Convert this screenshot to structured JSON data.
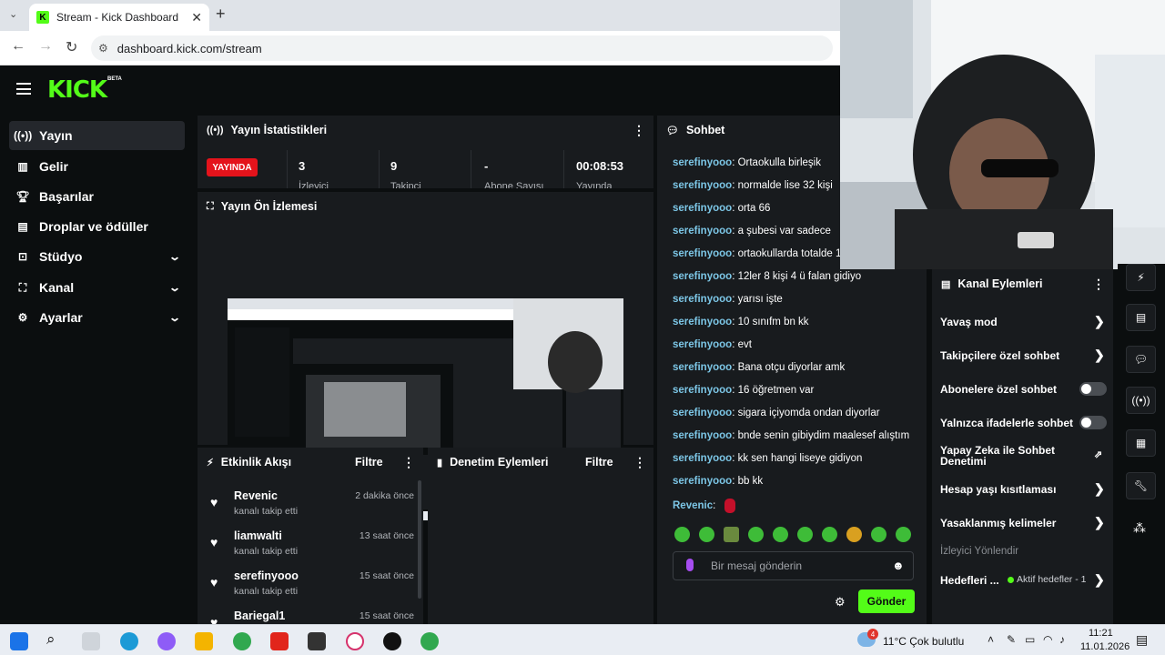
{
  "browser": {
    "tab_title": "Stream - Kick Dashboard",
    "tab_close": "✕",
    "new_tab": "+",
    "url": "dashboard.kick.com/stream"
  },
  "header": {
    "logo": "KICK",
    "beta": "BETA"
  },
  "sidebar": {
    "items": [
      {
        "label": "Yayın",
        "icon": "broadcast-icon",
        "active": true
      },
      {
        "label": "Gelir",
        "icon": "revenue-icon"
      },
      {
        "label": "Başarılar",
        "icon": "trophy-icon"
      },
      {
        "label": "Droplar ve ödüller",
        "icon": "gift-icon"
      },
      {
        "label": "Stüdyo",
        "icon": "studio-icon",
        "expandable": true
      },
      {
        "label": "Kanal",
        "icon": "channel-icon",
        "expandable": true
      },
      {
        "label": "Ayarlar",
        "icon": "gear-icon",
        "expandable": true
      }
    ]
  },
  "stats": {
    "title": "Yayın İstatistikleri",
    "live": "YAYINDA",
    "values": [
      "3",
      "9",
      "-",
      "00:08:53"
    ],
    "labels": [
      "İzleyici",
      "Takipçi",
      "Abone Sayısı",
      "Yayında"
    ]
  },
  "preview": {
    "title": "Yayın Ön İzlemesi"
  },
  "activity": {
    "title": "Etkinlik Akışı",
    "filter": "Filtre",
    "events": [
      {
        "name": "Revenic",
        "action": "kanalı takip etti",
        "time": "2 dakika önce"
      },
      {
        "name": "liamwalti",
        "action": "kanalı takip etti",
        "time": "13 saat önce"
      },
      {
        "name": "serefinyooo",
        "action": "kanalı takip etti",
        "time": "15 saat önce"
      },
      {
        "name": "Bariegal1",
        "action": "",
        "time": "15 saat önce"
      }
    ]
  },
  "moderation": {
    "title": "Denetim Eylemleri",
    "filter": "Filtre"
  },
  "chat": {
    "title": "Sohbet",
    "messages": [
      {
        "user": "serefinyooo",
        "text": "Ortaokulla birleşik"
      },
      {
        "user": "serefinyooo",
        "text": "normalde lise 32 kişi"
      },
      {
        "user": "serefinyooo",
        "text": "orta 66"
      },
      {
        "user": "serefinyooo",
        "text": "a şubesi var sadece"
      },
      {
        "user": "serefinyooo",
        "text": "ortaokullarda totalde 1"
      },
      {
        "user": "serefinyooo",
        "text": "12ler 8 kişi 4 ü falan gidiyo"
      },
      {
        "user": "serefinyooo",
        "text": "yarısı işte"
      },
      {
        "user": "serefinyooo",
        "text": "10 sınıfm bn kk"
      },
      {
        "user": "serefinyooo",
        "text": "evt"
      },
      {
        "user": "serefinyooo",
        "text": "Bana otçu diyorlar amk"
      },
      {
        "user": "serefinyooo",
        "text": "16 öğretmen var"
      },
      {
        "user": "serefinyooo",
        "text": "sigara içiyomda ondan diyorlar"
      },
      {
        "user": "serefinyooo",
        "text": "bnde senin gibiydim maalesef alıştım"
      },
      {
        "user": "serefinyooo",
        "text": "kk sen hangi liseye gidiyon"
      },
      {
        "user": "serefinyooo",
        "text": "bb kk"
      },
      {
        "user": "Revenic",
        "text": ""
      }
    ],
    "placeholder": "Bir mesaj gönderin",
    "send": "Gönder"
  },
  "channel_actions": {
    "title": "Kanal Eylemleri",
    "items": [
      {
        "label": "Yavaş mod",
        "type": "chevron"
      },
      {
        "label": "Takipçilere özel sohbet",
        "type": "chevron"
      },
      {
        "label": "Abonelere özel sohbet",
        "type": "toggle"
      },
      {
        "label": "Yalnızca ifadelerle sohbet",
        "type": "toggle"
      },
      {
        "label": "Yapay Zeka ile Sohbet Denetimi",
        "type": "external"
      },
      {
        "label": "Hesap yaşı kısıtlaması",
        "type": "chevron"
      },
      {
        "label": "Yasaklanmış kelimeler",
        "type": "chevron"
      }
    ],
    "section": "İzleyici Yönlendir",
    "goals": "Hedefleri ...",
    "goals_status": "Aktif hedefler - 1"
  },
  "taskbar": {
    "weather": "11°C  Çok bulutlu",
    "time": "11:21",
    "date": "11.01.2026",
    "badge": "4"
  },
  "colors": {
    "accent": "#53fc18",
    "live": "#e4131b",
    "username": "#7cc6e6",
    "panel": "#181b1e"
  }
}
